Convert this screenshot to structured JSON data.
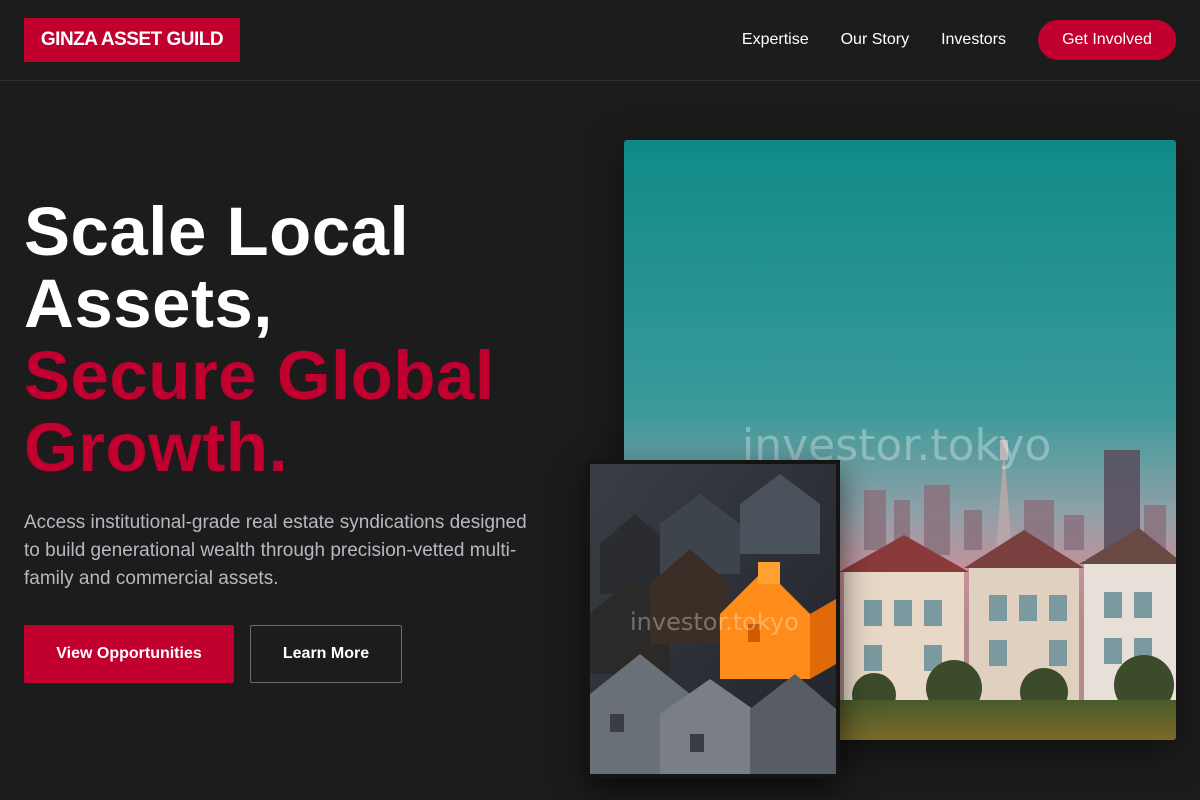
{
  "brand": {
    "name": "GINZA ASSET GUILD"
  },
  "nav": {
    "links": [
      "Expertise",
      "Our Story",
      "Investors"
    ],
    "cta": "Get Involved"
  },
  "hero": {
    "headline_lines": [
      "Scale Local",
      "Assets,"
    ],
    "headline_accent_lines": [
      "Secure Global",
      "Growth."
    ],
    "subtext": "Access institutional-grade real estate syndications designed to build generational wealth through precision-vetted multi-family and commercial assets.",
    "primary_cta": "View Opportunities",
    "secondary_cta": "Learn More"
  },
  "images": {
    "watermark": "investor.tokyo"
  },
  "colors": {
    "accent": "#c1002f",
    "background": "#1c1c1d",
    "subtext": "#b7b9c1"
  }
}
